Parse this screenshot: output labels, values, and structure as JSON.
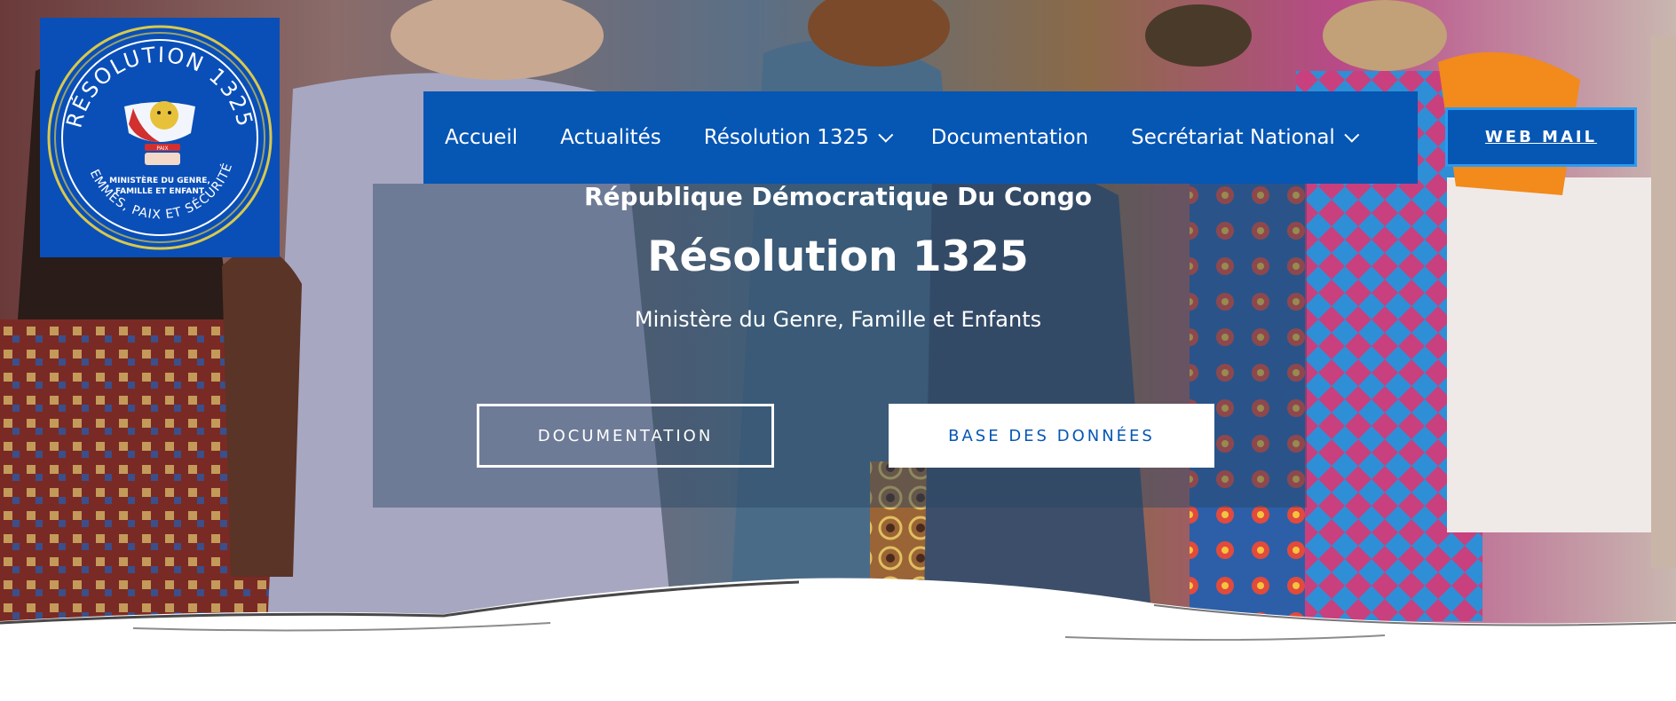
{
  "brand": {
    "logo_ring_text_top": "RÉSOLUTION 1325",
    "logo_ministry_line1": "MINISTÈRE DU GENRE,",
    "logo_ministry_line2": "FAMILLE ET ENFANT",
    "logo_ring_text_bottom": "FEMMES, PAIX ET SÉCURITÉ",
    "logo_emblem_motto": "PAIX",
    "colors": {
      "primary": "#0656b4",
      "accent_border": "#2a9bf0",
      "logo_bg": "#0a4fb8",
      "logo_ring": "#d9c84a"
    }
  },
  "nav": {
    "items": [
      {
        "label": "Accueil",
        "dropdown": false
      },
      {
        "label": "Actualités",
        "dropdown": false
      },
      {
        "label": "Résolution 1325",
        "dropdown": true
      },
      {
        "label": "Documentation",
        "dropdown": false
      },
      {
        "label": "Secrétariat National",
        "dropdown": true
      }
    ],
    "webmail_label": "WEB MAIL"
  },
  "hero": {
    "country": "République Démocratique Du Congo",
    "title": "Résolution 1325",
    "subtitle": "Ministère du Genre, Famille et Enfants",
    "primary_button": "DOCUMENTATION",
    "secondary_button": "BASE DES DONNÉES"
  }
}
